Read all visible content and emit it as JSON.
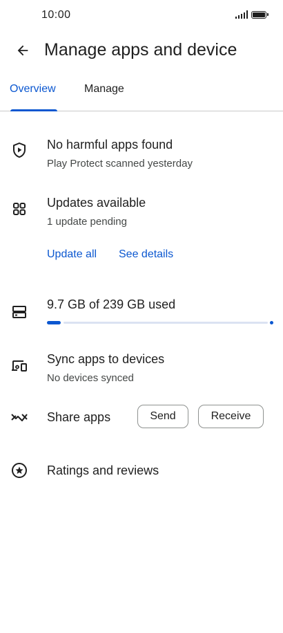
{
  "status_bar": {
    "time": "10:00"
  },
  "header": {
    "title": "Manage apps and device"
  },
  "tabs": [
    {
      "label": "Overview",
      "selected": true
    },
    {
      "label": "Manage",
      "selected": false
    }
  ],
  "protect": {
    "title": "No harmful apps found",
    "subtitle": "Play Protect scanned yesterday"
  },
  "updates": {
    "title": "Updates available",
    "subtitle": "1 update pending",
    "update_all_label": "Update all",
    "see_details_label": "See details"
  },
  "storage": {
    "label": "9.7 GB of 239 GB used",
    "used_gb": 9.7,
    "total_gb": 239
  },
  "sync": {
    "title": "Sync apps to devices",
    "subtitle": "No devices synced"
  },
  "share": {
    "title": "Share apps",
    "send_label": "Send",
    "receive_label": "Receive"
  },
  "ratings": {
    "title": "Ratings and reviews"
  },
  "colors": {
    "accent": "#0b57d0",
    "text": "#1f1f1f",
    "secondary_text": "#444746"
  }
}
